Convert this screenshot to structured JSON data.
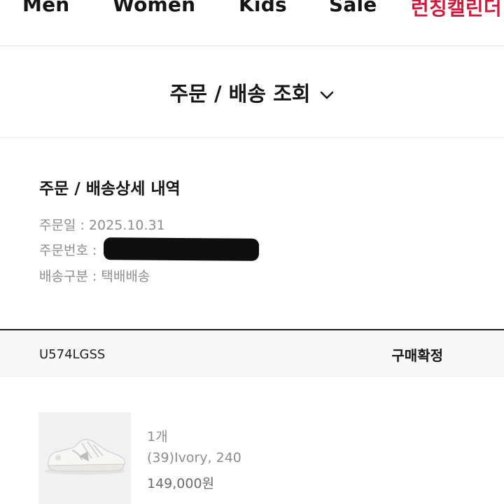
{
  "nav": {
    "items": [
      {
        "label": "Men"
      },
      {
        "label": "Women"
      },
      {
        "label": "Kids"
      },
      {
        "label": "Sale"
      },
      {
        "label": "런칭캘린더"
      }
    ],
    "accent_color": "#cf1a3c"
  },
  "section": {
    "title": "주문 / 배송 조회",
    "dropdown_icon": "chevron-down-icon"
  },
  "order_detail": {
    "heading": "주문 / 배송상세 내역",
    "order_date_label": "주문일 : ",
    "order_date": "2025.10.31",
    "order_number_label": "주문번호 : ",
    "order_number_note": "redacted",
    "delivery_type_label": "배송구분 : ",
    "delivery_type": "택배배송"
  },
  "product": {
    "code": "U574LGSS",
    "status": "구매확정",
    "image_icon": "sneaker-image",
    "quantity": "1개",
    "option": "(39)Ivory, 240",
    "price": "149,000원"
  }
}
